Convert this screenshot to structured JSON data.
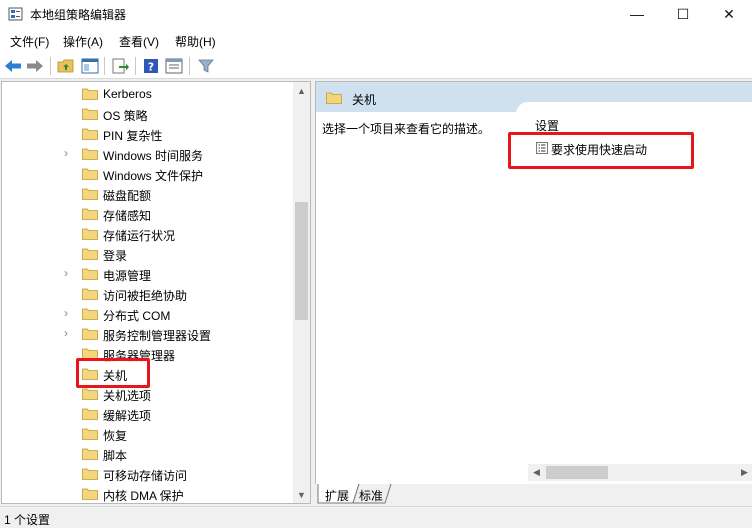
{
  "window": {
    "title": "本地组策略编辑器",
    "minimize": "—",
    "maximize": "☐",
    "close": "✕"
  },
  "menu": [
    "文件(F)",
    "操作(A)",
    "查看(V)",
    "帮助(H)"
  ],
  "tree": {
    "items": [
      {
        "label": "Kerberos",
        "expandable": false
      },
      {
        "label": "OS 策略",
        "expandable": false
      },
      {
        "label": "PIN 复杂性",
        "expandable": false
      },
      {
        "label": "Windows 时间服务",
        "expandable": true
      },
      {
        "label": "Windows 文件保护",
        "expandable": false
      },
      {
        "label": "磁盘配额",
        "expandable": false
      },
      {
        "label": "存储感知",
        "expandable": false
      },
      {
        "label": "存储运行状况",
        "expandable": false
      },
      {
        "label": "登录",
        "expandable": false
      },
      {
        "label": "电源管理",
        "expandable": true
      },
      {
        "label": "访问被拒绝协助",
        "expandable": false
      },
      {
        "label": "分布式 COM",
        "expandable": true
      },
      {
        "label": "服务控制管理器设置",
        "expandable": true
      },
      {
        "label": "服务器管理器",
        "expandable": false
      },
      {
        "label": "关机",
        "expandable": false,
        "selected": true
      },
      {
        "label": "关机选项",
        "expandable": false
      },
      {
        "label": "缓解选项",
        "expandable": false
      },
      {
        "label": "恢复",
        "expandable": false
      },
      {
        "label": "脚本",
        "expandable": false
      },
      {
        "label": "可移动存储访问",
        "expandable": false
      },
      {
        "label": "内核 DMA 保护",
        "expandable": false
      }
    ]
  },
  "detail": {
    "header": "关机",
    "description": "选择一个项目来查看它的描述。",
    "column_header": "设置",
    "settings": [
      "要求使用快速启动"
    ]
  },
  "tabs": [
    "扩展",
    "标准"
  ],
  "status": "1 个设置",
  "colors": {
    "highlight": "#e8151b",
    "header_bg": "#cfe1ee",
    "folder": "#e9c25c"
  }
}
